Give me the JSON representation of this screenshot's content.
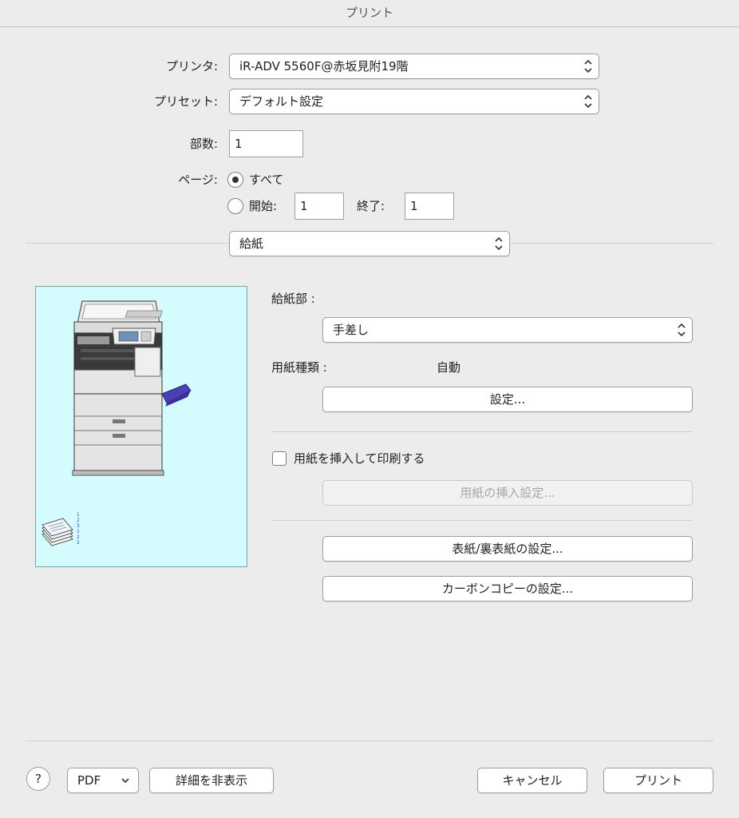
{
  "window": {
    "title": "プリント"
  },
  "printer": {
    "label": "プリンタ:",
    "value": "iR-ADV 5560F@赤坂見附19階"
  },
  "preset": {
    "label": "プリセット:",
    "value": "デフォルト設定"
  },
  "copies": {
    "label": "部数:",
    "value": "1"
  },
  "pages": {
    "label": "ページ:",
    "all_label": "すべて",
    "from_label": "開始:",
    "from_value": "1",
    "to_label": "終了:",
    "to_value": "1",
    "selected": "all"
  },
  "section": {
    "value": "給紙"
  },
  "paper_source": {
    "label": "給紙部 :",
    "value": "手差し"
  },
  "paper_type": {
    "label": "用紙種類 :",
    "value": "自動",
    "settings_button": "設定..."
  },
  "insert": {
    "checkbox_label": "用紙を挿入して印刷する",
    "checked": false,
    "settings_button": "用紙の挿入設定..."
  },
  "cover_button": "表紙/裏表紙の設定...",
  "carbon_button": "カーボンコピーの設定...",
  "footer": {
    "help": "?",
    "pdf_label": "PDF",
    "hide_details": "詳細を非表示",
    "cancel": "キャンセル",
    "print": "プリント"
  },
  "sheet_numbers": [
    "1",
    "2",
    "3",
    "1",
    "2",
    "3"
  ],
  "colors": {
    "preview_bg": "#d4fcfe",
    "tray_accent": "#4a3fb5"
  },
  "icons": [
    "updown-arrows-icon",
    "chevron-down-icon",
    "printer-illustration",
    "collated-pages-icon"
  ]
}
